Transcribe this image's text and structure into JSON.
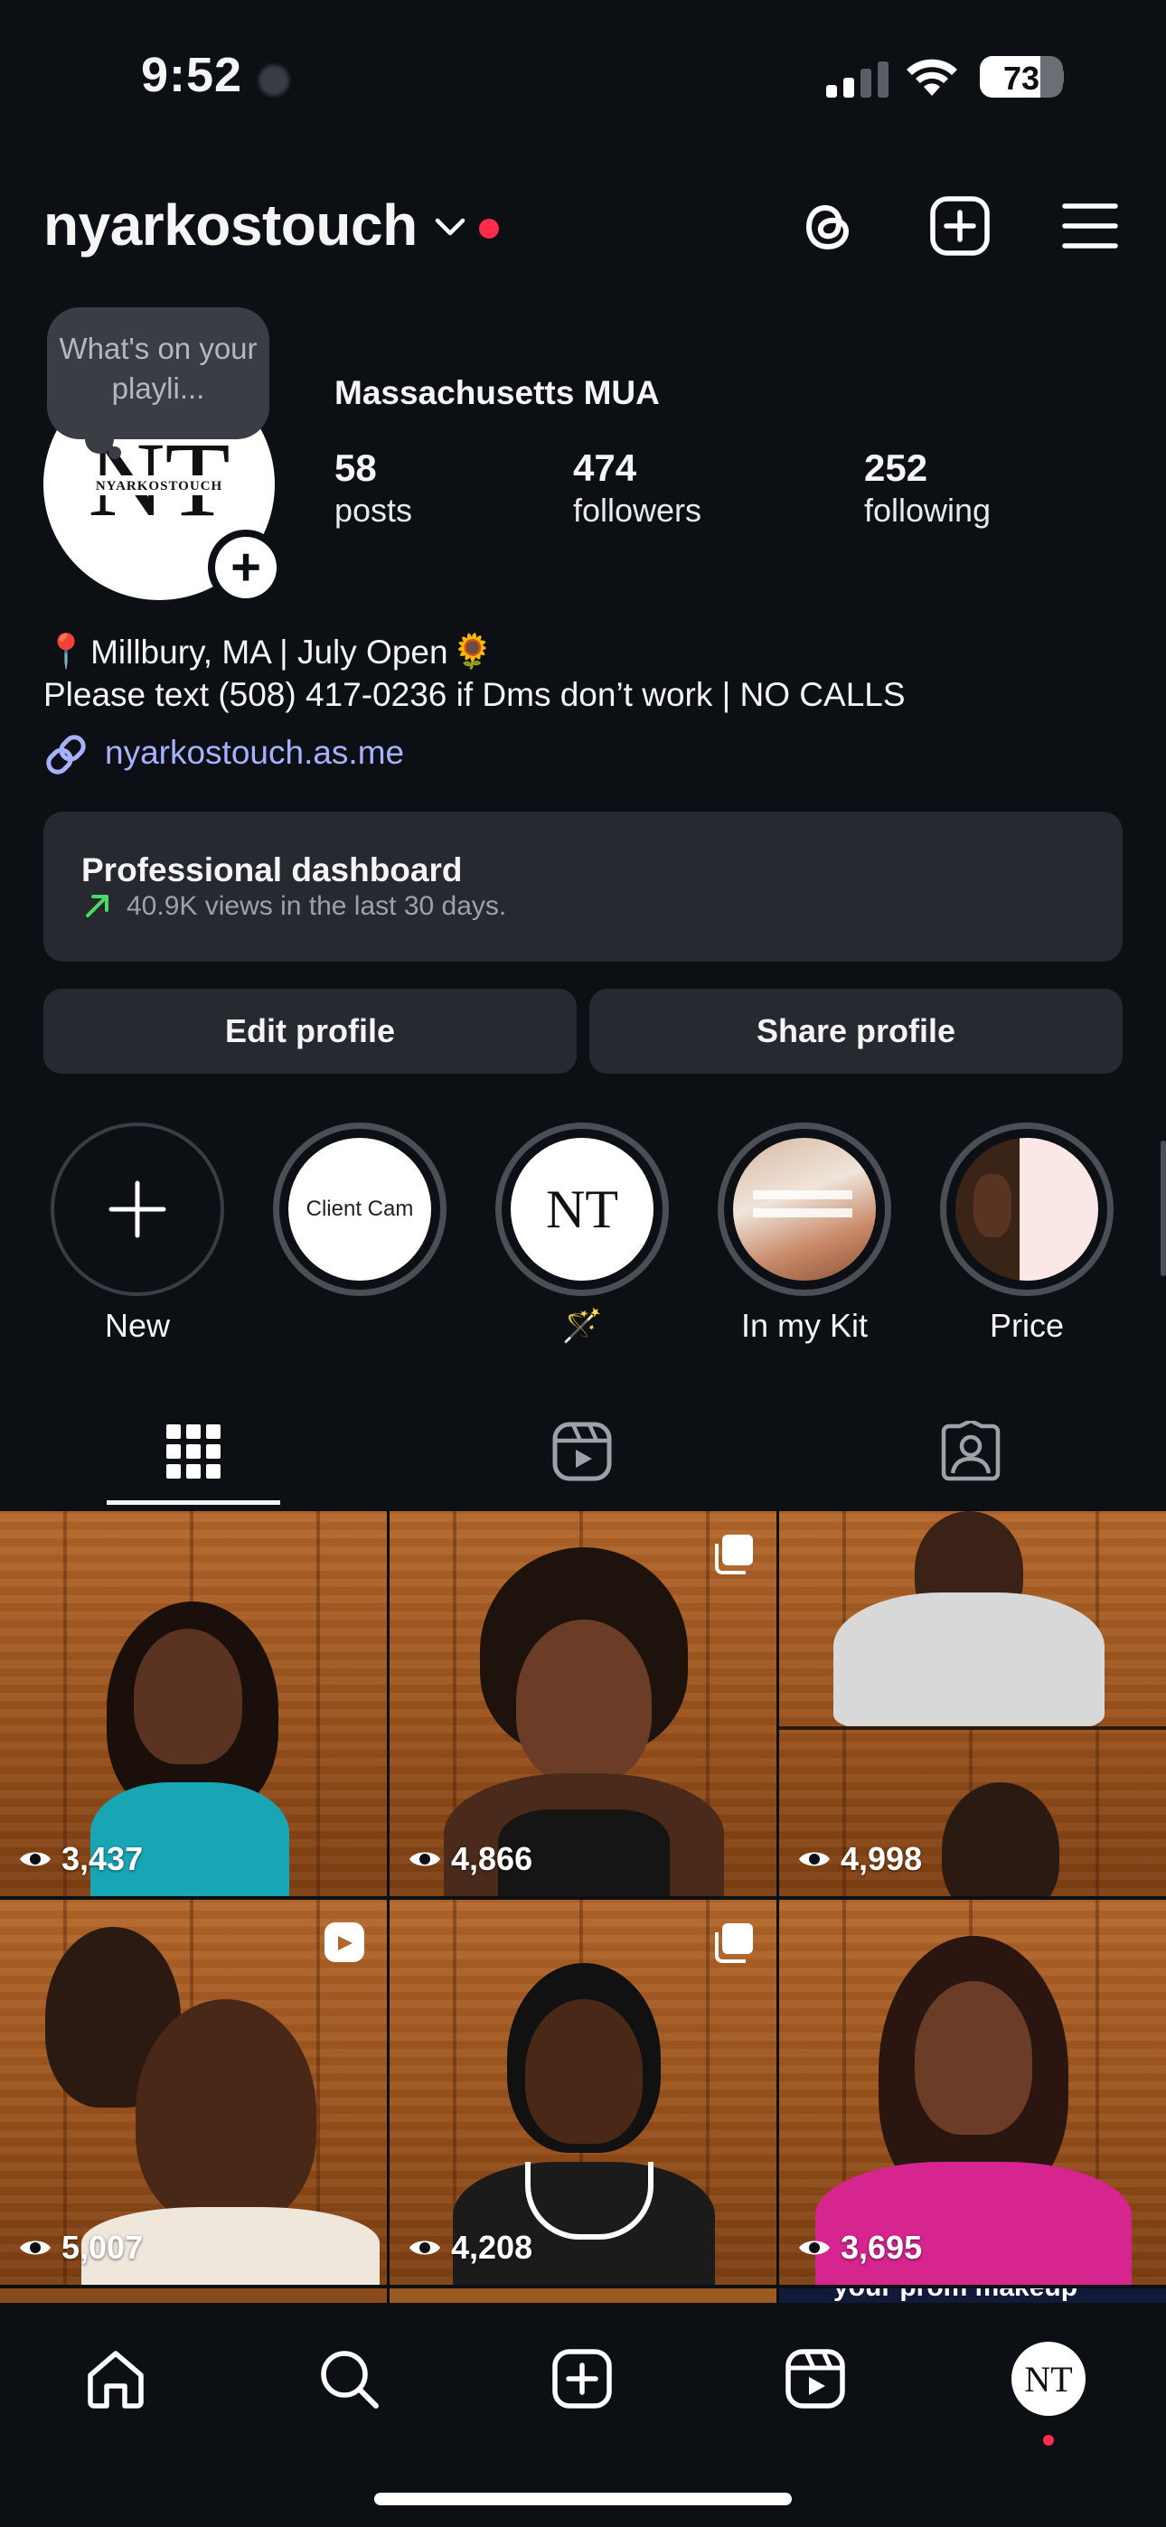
{
  "status_bar": {
    "time": "9:52",
    "battery": "73",
    "battery_level": 0.73
  },
  "header": {
    "username": "nyarkostouch",
    "icons": [
      "threads-icon",
      "create-post-icon",
      "menu-icon"
    ],
    "notification_dot_color": "#ff2d4b"
  },
  "profile": {
    "avatar_monogram": "NT",
    "avatar_wordmark": "NYARKOSTOUCH",
    "note": "What's on your playli...",
    "category": "Massachusetts MUA",
    "stats": [
      {
        "value": "58",
        "label": "posts"
      },
      {
        "value": "474",
        "label": "followers"
      },
      {
        "value": "252",
        "label": "following"
      }
    ],
    "bio_line1": "Millbury, MA | July Open",
    "bio_line2": "Please text (508) 417-0236 if Dms don’t work | NO CALLS",
    "link": "nyarkostouch.as.me"
  },
  "dashboard": {
    "title": "Professional dashboard",
    "subtitle": "40.9K views in the last 30 days."
  },
  "buttons": {
    "edit": "Edit profile",
    "share": "Share profile"
  },
  "highlights": [
    {
      "label": "New",
      "inner_text": ""
    },
    {
      "label": "",
      "inner_text": "Client Cam"
    },
    {
      "label": "🪄",
      "inner_text": "NT"
    },
    {
      "label": "In my Kit",
      "inner_text": ""
    },
    {
      "label": "Price",
      "inner_text": ""
    }
  ],
  "tabs": [
    "grid-tab",
    "reels-tab",
    "tagged-tab"
  ],
  "grid": [
    {
      "views": "3,437",
      "badge": ""
    },
    {
      "views": "4,866",
      "badge": "carousel"
    },
    {
      "views": "4,998",
      "badge": ""
    },
    {
      "views": "5,007",
      "badge": "reel"
    },
    {
      "views": "4,208",
      "badge": "carousel"
    },
    {
      "views": "3,695",
      "badge": ""
    }
  ],
  "grid_peek_text": "your prom makeup",
  "bottom_nav": [
    "home",
    "search",
    "create",
    "reels",
    "profile"
  ],
  "colors": {
    "background": "#0c0f14",
    "surface": "#26292f",
    "link": "#a6b1ff",
    "accent_red": "#ff2d4b",
    "trend_green": "#4cd964"
  }
}
